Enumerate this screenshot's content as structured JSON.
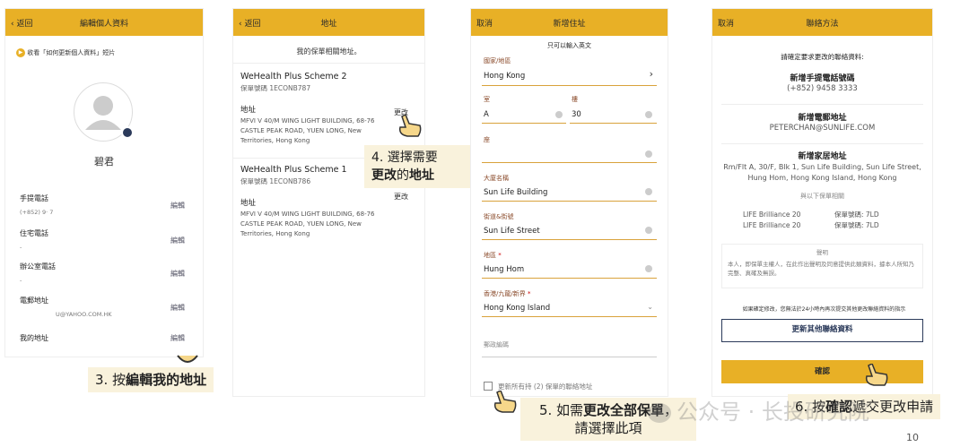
{
  "screen1": {
    "back": "返回",
    "title": "編輯個人資料",
    "video_text": "收看「如何更新個人資料」短片",
    "name": "碧君",
    "rows": [
      {
        "label": "手提電話",
        "value": "(+852) 9·          7",
        "edit": "編輯"
      },
      {
        "label": "住宅電話",
        "value": "-",
        "edit": "編輯"
      },
      {
        "label": "辦公室電話",
        "value": "-",
        "edit": "編輯"
      },
      {
        "label": "電郵地址",
        "value": "U@YAHOO.COM.HK",
        "edit": "編輯"
      },
      {
        "label": "我的地址",
        "value": "",
        "edit": "編輯"
      }
    ]
  },
  "screen2": {
    "back": "返回",
    "title": "地址",
    "subtitle": "我的保單相關地址。",
    "policies": [
      {
        "name": "WeHealth Plus Scheme 2",
        "number": "保單號碼 1ECONB787",
        "addr_label": "地址",
        "address": "MFVI V 40/M WING LIGHT BUILDING, 68-76 CASTLE PEAK ROAD, YUEN LONG, New Territories, Hong Kong",
        "change": "更改"
      },
      {
        "name": "WeHealth Plus Scheme 1",
        "number": "保單號碼 1ECONB786",
        "addr_label": "地址",
        "address": "MFVI V 40/M WING LIGHT BUILDING, 68-76 CASTLE PEAK ROAD, YUEN LONG, New Territories, Hong Kong",
        "change": "更改"
      }
    ]
  },
  "screen3": {
    "cancel": "取消",
    "title": "新增住址",
    "hint": "只可以輸入英文",
    "country_label": "國家/地區",
    "country": "Hong Kong",
    "flat_label": "室",
    "flat": "A",
    "floor_label": "樓",
    "floor": "30",
    "block_label": "座",
    "block": "",
    "building_label": "大廈名稱",
    "building": "Sun Life Building",
    "street_label": "街道&街號",
    "street": "Sun Life Street",
    "district_label": "地區",
    "district": "Hung Hom",
    "region_label": "香港/九龍/新界",
    "region": "Hong Kong Island",
    "postal_label": "郵政編碼",
    "checkbox_label": "更新所有持 (2) 保單的聯絡地址"
  },
  "screen4": {
    "cancel": "取消",
    "title": "聯絡方法",
    "confirm_text": "請確定要求更改的聯絡資料:",
    "mobile_title": "新增手提電話號碼",
    "mobile": "(+852) 9458 3333",
    "email_title": "新增電郵地址",
    "email": "PETERCHAN@SUNLIFE.COM",
    "home_title": "新增家居地址",
    "home": "Rm/Flt A, 30/F, Blk 1, Sun Life Building, Sun Life Street, Hung Hom, Hong Kong Island, Hong Kong",
    "related": "與以下保單相關",
    "policies": [
      {
        "name": "LIFE Brilliance 20",
        "no": "保單號碼: 7LD"
      },
      {
        "name": "LIFE Brilliance 20",
        "no": "保單號碼: 7LD"
      }
    ],
    "decl_title": "聲明",
    "decl": "本人，即保單主權人，在此作出聲明及同意提供此類資料，據本人所知乃完整、真確及無誤。",
    "notice": "如果確定修改，您無法於24小時內再次提交其他更改聯絡資料的指示",
    "update_btn": "更新其他聯絡資料",
    "confirm_btn": "確認"
  },
  "callouts": {
    "c3a": "3. 按",
    "c3b": "編輯我的地址",
    "c4a": "4. 選擇需要",
    "c4b": "更改",
    "c4c": "的",
    "c4d": "地址",
    "c5a": "5. 如需",
    "c5b": "更改全部保單",
    "c5c": "，",
    "c5d": "請選擇此項",
    "c6a": "6. 按",
    "c6b": "確認",
    "c6c": "遞交更改申請"
  },
  "watermark": "公众号 · 长投研究院",
  "page_number": "10",
  "colors": {
    "accent": "#e8b026",
    "callout_bg": "#f9f2dc"
  }
}
